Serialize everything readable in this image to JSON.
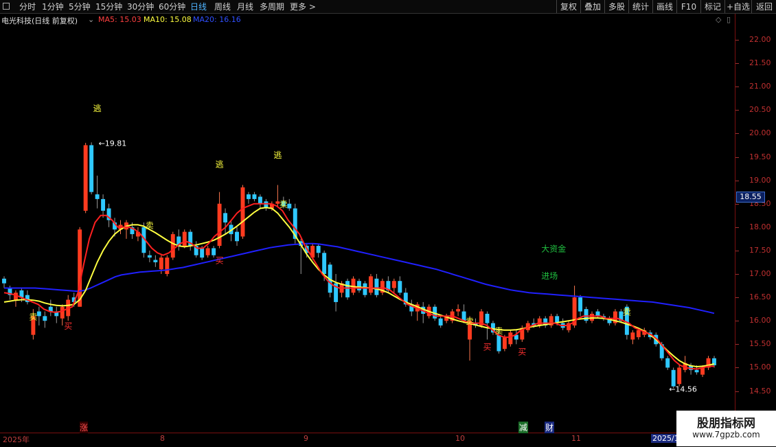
{
  "toolbar": {
    "periods": [
      "分时",
      "1分钟",
      "5分钟",
      "15分钟",
      "30分钟",
      "60分钟",
      "日线",
      "周线",
      "月线",
      "多周期",
      "更多 >"
    ],
    "active_period": "日线",
    "right_buttons": [
      "复权",
      "叠加",
      "多股",
      "统计",
      "画线",
      "F10",
      "标记",
      "+自选",
      "返回"
    ]
  },
  "info": {
    "title": "电光科技(日线 前复权)",
    "dropdown_glyph": "⌄",
    "ma5": "MA5: 15.03",
    "ma10": "MA10: 15.08",
    "ma20": "MA20: 16.16",
    "diamond_glyph": "◇",
    "scroll_glyph": "▯"
  },
  "axis": {
    "ticks": [
      "22.00",
      "21.50",
      "21.00",
      "20.50",
      "20.00",
      "19.50",
      "19.00",
      "18.50",
      "18.00",
      "17.50",
      "17.00",
      "16.50",
      "16.00",
      "15.50",
      "15.00",
      "14.50"
    ],
    "last_price": "18.55"
  },
  "footer": {
    "dates": [
      "2025年",
      "8",
      "9",
      "10",
      "11",
      "2025/1"
    ],
    "markers": [
      "涨",
      "减",
      "财"
    ]
  },
  "watermark": {
    "line1": "股朋指标网",
    "line2": "www.7gpzb.com"
  },
  "colors": {
    "up": "#ff3b1f",
    "down": "#2fc8ff",
    "ma5": "#ff2020",
    "ma10": "#ffff40",
    "ma20": "#2020ff",
    "buy": "#ff3030",
    "sell": "#ffff40",
    "escape": "#ffff40",
    "fund": "#20c040"
  },
  "chart_data": {
    "type": "candlestick",
    "ylim": [
      14.2,
      22.3
    ],
    "candles": [
      {
        "o": 16.9,
        "c": 16.8,
        "h": 16.95,
        "l": 16.7
      },
      {
        "o": 16.7,
        "c": 16.55,
        "h": 16.75,
        "l": 16.45
      },
      {
        "o": 16.45,
        "c": 16.6,
        "h": 16.65,
        "l": 16.3
      },
      {
        "o": 16.65,
        "c": 16.5,
        "h": 16.7,
        "l": 16.4
      },
      {
        "o": 16.55,
        "c": 16.4,
        "h": 16.65,
        "l": 16.35
      },
      {
        "o": 15.7,
        "c": 16.1,
        "h": 16.25,
        "l": 15.6
      },
      {
        "o": 16.2,
        "c": 16.1,
        "h": 16.3,
        "l": 15.9
      },
      {
        "o": 16.1,
        "c": 16.0,
        "h": 16.2,
        "l": 15.85
      },
      {
        "o": 16.3,
        "c": 16.2,
        "h": 16.45,
        "l": 16.1
      },
      {
        "o": 16.2,
        "c": 16.1,
        "h": 16.3,
        "l": 15.95
      },
      {
        "o": 16.05,
        "c": 16.3,
        "h": 16.35,
        "l": 15.9
      },
      {
        "o": 16.1,
        "c": 16.45,
        "h": 16.55,
        "l": 16.0
      },
      {
        "o": 16.5,
        "c": 16.4,
        "h": 16.6,
        "l": 16.3
      },
      {
        "o": 16.3,
        "c": 17.95,
        "h": 18.0,
        "l": 16.3
      },
      {
        "o": 18.35,
        "c": 19.75,
        "h": 19.8,
        "l": 18.3
      },
      {
        "o": 19.75,
        "c": 18.75,
        "h": 19.81,
        "l": 18.7
      },
      {
        "o": 18.7,
        "c": 18.6,
        "h": 19.1,
        "l": 18.4
      },
      {
        "o": 18.6,
        "c": 18.35,
        "h": 18.7,
        "l": 18.2
      },
      {
        "o": 18.4,
        "c": 18.15,
        "h": 18.5,
        "l": 18.0
      },
      {
        "o": 18.1,
        "c": 17.95,
        "h": 18.2,
        "l": 17.8
      },
      {
        "o": 17.95,
        "c": 18.05,
        "h": 18.15,
        "l": 17.85
      },
      {
        "o": 17.95,
        "c": 18.1,
        "h": 18.15,
        "l": 17.75
      },
      {
        "o": 18.0,
        "c": 17.85,
        "h": 18.1,
        "l": 17.75
      },
      {
        "o": 17.8,
        "c": 17.9,
        "h": 18.0,
        "l": 17.7
      },
      {
        "o": 18.0,
        "c": 17.45,
        "h": 18.1,
        "l": 17.35
      },
      {
        "o": 17.4,
        "c": 17.35,
        "h": 17.5,
        "l": 17.25
      },
      {
        "o": 17.3,
        "c": 17.25,
        "h": 17.4,
        "l": 17.15
      },
      {
        "o": 17.1,
        "c": 17.35,
        "h": 17.4,
        "l": 17.0
      },
      {
        "o": 17.0,
        "c": 17.35,
        "h": 17.4,
        "l": 16.95
      },
      {
        "o": 17.35,
        "c": 17.85,
        "h": 17.9,
        "l": 17.3
      },
      {
        "o": 17.8,
        "c": 17.6,
        "h": 17.95,
        "l": 17.5
      },
      {
        "o": 17.6,
        "c": 17.9,
        "h": 17.95,
        "l": 17.55
      },
      {
        "o": 17.9,
        "c": 17.6,
        "h": 17.95,
        "l": 17.5
      },
      {
        "o": 17.6,
        "c": 17.4,
        "h": 17.7,
        "l": 17.35
      },
      {
        "o": 17.55,
        "c": 17.35,
        "h": 17.6,
        "l": 17.3
      },
      {
        "o": 17.4,
        "c": 17.55,
        "h": 17.6,
        "l": 17.35
      },
      {
        "o": 17.55,
        "c": 17.4,
        "h": 17.6,
        "l": 17.35
      },
      {
        "o": 17.6,
        "c": 18.5,
        "h": 18.75,
        "l": 17.55
      },
      {
        "o": 18.3,
        "c": 18.1,
        "h": 18.4,
        "l": 17.85
      },
      {
        "o": 18.05,
        "c": 17.85,
        "h": 18.15,
        "l": 17.7
      },
      {
        "o": 17.9,
        "c": 17.7,
        "h": 18.0,
        "l": 17.6
      },
      {
        "o": 17.8,
        "c": 18.85,
        "h": 18.9,
        "l": 17.75
      },
      {
        "o": 18.7,
        "c": 18.6,
        "h": 18.75,
        "l": 18.5
      },
      {
        "o": 18.7,
        "c": 18.6,
        "h": 18.75,
        "l": 18.55
      },
      {
        "o": 18.65,
        "c": 18.5,
        "h": 18.7,
        "l": 18.4
      },
      {
        "o": 18.55,
        "c": 18.4,
        "h": 18.6,
        "l": 18.35
      },
      {
        "o": 18.4,
        "c": 18.5,
        "h": 18.55,
        "l": 18.35
      },
      {
        "o": 18.5,
        "c": 18.55,
        "h": 18.9,
        "l": 18.45
      },
      {
        "o": 18.55,
        "c": 18.45,
        "h": 18.65,
        "l": 18.4
      },
      {
        "o": 18.5,
        "c": 18.4,
        "h": 18.6,
        "l": 18.35
      },
      {
        "o": 18.4,
        "c": 17.75,
        "h": 18.5,
        "l": 17.65
      },
      {
        "o": 17.7,
        "c": 17.6,
        "h": 17.75,
        "l": 17.0
      },
      {
        "o": 17.6,
        "c": 17.45,
        "h": 17.65,
        "l": 17.35
      },
      {
        "o": 17.35,
        "c": 17.6,
        "h": 17.65,
        "l": 17.3
      },
      {
        "o": 17.6,
        "c": 17.45,
        "h": 17.65,
        "l": 17.35
      },
      {
        "o": 17.45,
        "c": 17.0,
        "h": 17.5,
        "l": 16.85
      },
      {
        "o": 17.2,
        "c": 16.6,
        "h": 17.25,
        "l": 16.5
      },
      {
        "o": 16.8,
        "c": 16.4,
        "h": 17.0,
        "l": 16.2
      },
      {
        "o": 16.6,
        "c": 16.8,
        "h": 16.85,
        "l": 16.5
      },
      {
        "o": 16.85,
        "c": 16.5,
        "h": 16.9,
        "l": 16.45
      },
      {
        "o": 16.6,
        "c": 16.9,
        "h": 16.95,
        "l": 16.55
      },
      {
        "o": 16.85,
        "c": 16.65,
        "h": 16.9,
        "l": 16.6
      },
      {
        "o": 16.8,
        "c": 16.55,
        "h": 16.85,
        "l": 16.5
      },
      {
        "o": 16.6,
        "c": 16.95,
        "h": 17.0,
        "l": 16.55
      },
      {
        "o": 16.9,
        "c": 16.55,
        "h": 17.0,
        "l": 16.5
      },
      {
        "o": 16.6,
        "c": 16.85,
        "h": 16.9,
        "l": 16.55
      },
      {
        "o": 16.85,
        "c": 16.65,
        "h": 16.95,
        "l": 16.6
      },
      {
        "o": 16.7,
        "c": 16.85,
        "h": 16.9,
        "l": 16.6
      },
      {
        "o": 16.85,
        "c": 16.6,
        "h": 16.95,
        "l": 16.55
      },
      {
        "o": 16.6,
        "c": 16.35,
        "h": 16.7,
        "l": 16.3
      },
      {
        "o": 16.35,
        "c": 16.2,
        "h": 16.45,
        "l": 16.1
      },
      {
        "o": 16.2,
        "c": 16.35,
        "h": 16.4,
        "l": 16.0
      },
      {
        "o": 16.3,
        "c": 16.15,
        "h": 16.4,
        "l": 15.95
      },
      {
        "o": 16.1,
        "c": 16.3,
        "h": 16.35,
        "l": 16.05
      },
      {
        "o": 16.3,
        "c": 16.05,
        "h": 16.35,
        "l": 16.0
      },
      {
        "o": 16.05,
        "c": 15.9,
        "h": 16.1,
        "l": 15.85
      },
      {
        "o": 16.0,
        "c": 16.1,
        "h": 16.15,
        "l": 15.95
      },
      {
        "o": 16.0,
        "c": 16.2,
        "h": 16.25,
        "l": 15.95
      },
      {
        "o": 16.2,
        "c": 16.25,
        "h": 16.35,
        "l": 16.1
      },
      {
        "o": 16.2,
        "c": 16.0,
        "h": 16.35,
        "l": 15.95
      },
      {
        "o": 15.6,
        "c": 16.0,
        "h": 16.1,
        "l": 15.15
      },
      {
        "o": 15.95,
        "c": 15.9,
        "h": 16.05,
        "l": 15.85
      },
      {
        "o": 15.9,
        "c": 16.2,
        "h": 16.25,
        "l": 15.85
      },
      {
        "o": 16.15,
        "c": 15.95,
        "h": 16.2,
        "l": 15.6
      },
      {
        "o": 15.95,
        "c": 15.75,
        "h": 16.0,
        "l": 15.7
      },
      {
        "o": 15.7,
        "c": 15.35,
        "h": 15.8,
        "l": 15.3
      },
      {
        "o": 15.4,
        "c": 15.65,
        "h": 15.7,
        "l": 15.35
      },
      {
        "o": 15.5,
        "c": 15.75,
        "h": 15.8,
        "l": 15.45
      },
      {
        "o": 15.7,
        "c": 15.6,
        "h": 15.8,
        "l": 15.5
      },
      {
        "o": 15.6,
        "c": 15.85,
        "h": 15.9,
        "l": 15.55
      },
      {
        "o": 15.8,
        "c": 15.95,
        "h": 16.0,
        "l": 15.75
      },
      {
        "o": 15.95,
        "c": 15.9,
        "h": 16.05,
        "l": 15.85
      },
      {
        "o": 15.9,
        "c": 16.05,
        "h": 16.1,
        "l": 15.85
      },
      {
        "o": 16.05,
        "c": 15.9,
        "h": 16.1,
        "l": 15.85
      },
      {
        "o": 15.9,
        "c": 16.1,
        "h": 16.15,
        "l": 15.85
      },
      {
        "o": 16.1,
        "c": 15.95,
        "h": 16.15,
        "l": 15.9
      },
      {
        "o": 15.95,
        "c": 15.85,
        "h": 16.05,
        "l": 15.8
      },
      {
        "o": 15.8,
        "c": 15.95,
        "h": 16.0,
        "l": 15.75
      },
      {
        "o": 15.9,
        "c": 16.5,
        "h": 16.75,
        "l": 15.85
      },
      {
        "o": 16.5,
        "c": 16.2,
        "h": 16.55,
        "l": 16.1
      },
      {
        "o": 16.25,
        "c": 16.0,
        "h": 16.3,
        "l": 15.95
      },
      {
        "o": 16.0,
        "c": 16.15,
        "h": 16.2,
        "l": 15.95
      },
      {
        "o": 16.2,
        "c": 16.1,
        "h": 16.25,
        "l": 16.05
      },
      {
        "o": 16.1,
        "c": 16.05,
        "h": 16.15,
        "l": 16.0
      },
      {
        "o": 16.05,
        "c": 15.95,
        "h": 16.1,
        "l": 15.9
      },
      {
        "o": 15.95,
        "c": 16.2,
        "h": 16.25,
        "l": 15.9
      },
      {
        "o": 16.2,
        "c": 16.0,
        "h": 16.25,
        "l": 15.95
      },
      {
        "o": 16.3,
        "c": 15.7,
        "h": 16.35,
        "l": 15.6
      },
      {
        "o": 15.6,
        "c": 15.75,
        "h": 15.8,
        "l": 15.5
      },
      {
        "o": 15.65,
        "c": 15.8,
        "h": 15.85,
        "l": 15.6
      },
      {
        "o": 15.7,
        "c": 15.8,
        "h": 15.85,
        "l": 15.65
      },
      {
        "o": 15.75,
        "c": 15.65,
        "h": 15.8,
        "l": 15.6
      },
      {
        "o": 15.7,
        "c": 15.5,
        "h": 15.75,
        "l": 15.45
      },
      {
        "o": 15.5,
        "c": 15.2,
        "h": 15.55,
        "l": 15.15
      },
      {
        "o": 15.2,
        "c": 15.0,
        "h": 15.25,
        "l": 14.95
      },
      {
        "o": 14.95,
        "c": 14.6,
        "h": 15.0,
        "l": 14.56
      },
      {
        "o": 14.65,
        "c": 15.0,
        "h": 15.05,
        "l": 14.6
      },
      {
        "o": 14.95,
        "c": 15.1,
        "h": 15.25,
        "l": 14.9
      },
      {
        "o": 15.05,
        "c": 14.95,
        "h": 15.1,
        "l": 14.85
      },
      {
        "o": 14.95,
        "c": 14.9,
        "h": 15.05,
        "l": 14.85
      },
      {
        "o": 14.85,
        "c": 15.0,
        "h": 15.05,
        "l": 14.8
      },
      {
        "o": 15.0,
        "c": 15.2,
        "h": 15.25,
        "l": 14.95
      },
      {
        "o": 15.2,
        "c": 15.05,
        "h": 15.25,
        "l": 15.0
      }
    ],
    "ma5": [
      16.6,
      16.58,
      16.55,
      16.5,
      16.45,
      16.4,
      16.35,
      16.25,
      16.2,
      16.18,
      16.2,
      16.25,
      16.3,
      16.6,
      17.2,
      17.75,
      18.1,
      18.25,
      18.25,
      18.15,
      18.0,
      18.0,
      18.0,
      17.95,
      17.85,
      17.7,
      17.55,
      17.45,
      17.4,
      17.45,
      17.55,
      17.65,
      17.7,
      17.65,
      17.55,
      17.55,
      17.65,
      17.8,
      17.9,
      18.0,
      18.15,
      18.3,
      18.4,
      18.45,
      18.5,
      18.5,
      18.5,
      18.5,
      18.45,
      18.35,
      18.15,
      18.0,
      17.85,
      17.6,
      17.4,
      17.2,
      17.0,
      16.85,
      16.75,
      16.7,
      16.7,
      16.7,
      16.7,
      16.7,
      16.7,
      16.7,
      16.7,
      16.7,
      16.65,
      16.55,
      16.45,
      16.35,
      16.3,
      16.25,
      16.2,
      16.15,
      16.1,
      16.1,
      16.1,
      16.1,
      16.05,
      16.0,
      15.95,
      15.95,
      15.95,
      15.9,
      15.8,
      15.7,
      15.65,
      15.65,
      15.7,
      15.8,
      15.85,
      15.9,
      15.95,
      15.95,
      15.95,
      15.95,
      15.9,
      15.9,
      15.95,
      16.05,
      16.1,
      16.1,
      16.1,
      16.1,
      16.05,
      16.05,
      16.05,
      16.0,
      15.95,
      15.85,
      15.8,
      15.75,
      15.7,
      15.6,
      15.45,
      15.3,
      15.15,
      15.05,
      15.0,
      14.98,
      14.97,
      15.0,
      15.03,
      15.03
    ],
    "ma10": [
      16.4,
      16.42,
      16.44,
      16.45,
      16.45,
      16.44,
      16.42,
      16.38,
      16.35,
      16.33,
      16.32,
      16.33,
      16.35,
      16.45,
      16.65,
      16.95,
      17.25,
      17.5,
      17.7,
      17.85,
      17.95,
      18.02,
      18.05,
      18.05,
      18.02,
      17.95,
      17.88,
      17.8,
      17.72,
      17.65,
      17.6,
      17.58,
      17.6,
      17.62,
      17.65,
      17.68,
      17.72,
      17.78,
      17.85,
      17.93,
      18.02,
      18.12,
      18.22,
      18.32,
      18.4,
      18.42,
      18.4,
      18.3,
      18.15,
      18.0,
      17.82,
      17.62,
      17.42,
      17.25,
      17.1,
      16.98,
      16.88,
      16.82,
      16.78,
      16.75,
      16.73,
      16.72,
      16.71,
      16.7,
      16.68,
      16.65,
      16.6,
      16.53,
      16.46,
      16.4,
      16.35,
      16.3,
      16.25,
      16.2,
      16.16,
      16.12,
      16.08,
      16.04,
      16.0,
      15.97,
      15.94,
      15.91,
      15.88,
      15.85,
      15.83,
      15.81,
      15.8,
      15.8,
      15.81,
      15.83,
      15.86,
      15.88,
      15.9,
      15.92,
      15.94,
      15.96,
      15.98,
      16.0,
      16.02,
      16.04,
      16.05,
      16.06,
      16.06,
      16.05,
      16.03,
      16.0,
      15.97,
      15.93,
      15.89,
      15.84,
      15.78,
      15.7,
      15.6,
      15.48,
      15.36,
      15.25,
      15.15,
      15.08,
      15.04,
      15.02,
      15.03,
      15.05,
      15.08
    ],
    "ma20": [
      16.7,
      16.7,
      16.7,
      16.7,
      16.7,
      16.7,
      16.69,
      16.68,
      16.67,
      16.66,
      16.65,
      16.64,
      16.63,
      16.65,
      16.7,
      16.76,
      16.82,
      16.88,
      16.94,
      16.98,
      17.0,
      17.02,
      17.04,
      17.05,
      17.06,
      17.07,
      17.08,
      17.1,
      17.12,
      17.14,
      17.17,
      17.2,
      17.23,
      17.26,
      17.29,
      17.32,
      17.35,
      17.38,
      17.41,
      17.44,
      17.47,
      17.5,
      17.53,
      17.56,
      17.58,
      17.6,
      17.62,
      17.63,
      17.64,
      17.65,
      17.65,
      17.64,
      17.62,
      17.6,
      17.58,
      17.55,
      17.52,
      17.49,
      17.46,
      17.43,
      17.4,
      17.37,
      17.34,
      17.31,
      17.28,
      17.25,
      17.22,
      17.19,
      17.16,
      17.13,
      17.1,
      17.06,
      17.02,
      16.98,
      16.94,
      16.9,
      16.86,
      16.82,
      16.78,
      16.75,
      16.72,
      16.69,
      16.66,
      16.64,
      16.62,
      16.6,
      16.59,
      16.58,
      16.57,
      16.56,
      16.55,
      16.54,
      16.53,
      16.52,
      16.51,
      16.5,
      16.49,
      16.48,
      16.47,
      16.46,
      16.45,
      16.44,
      16.43,
      16.42,
      16.41,
      16.4,
      16.38,
      16.36,
      16.34,
      16.32,
      16.3,
      16.28,
      16.25,
      16.22,
      16.19,
      16.16
    ],
    "annotations": [
      {
        "text": "逃",
        "i": 16,
        "price": 20.55,
        "kind": "escape"
      },
      {
        "text": "逃",
        "i": 37,
        "price": 19.35,
        "kind": "escape"
      },
      {
        "text": "逃",
        "i": 47,
        "price": 19.55,
        "kind": "escape"
      },
      {
        "text": "卖",
        "i": 48,
        "price": 18.5,
        "kind": "sell"
      },
      {
        "text": "卖",
        "i": 5,
        "price": 16.1,
        "kind": "sell"
      },
      {
        "text": "买",
        "i": 11,
        "price": 15.9,
        "kind": "buy"
      },
      {
        "text": "卖",
        "i": 25,
        "price": 18.05,
        "kind": "sell"
      },
      {
        "text": "买",
        "i": 37,
        "price": 17.3,
        "kind": "buy"
      },
      {
        "text": "卖",
        "i": 80,
        "price": 16.0,
        "kind": "sell"
      },
      {
        "text": "卖",
        "i": 85,
        "price": 15.8,
        "kind": "sell"
      },
      {
        "text": "买",
        "i": 83,
        "price": 15.45,
        "kind": "buy"
      },
      {
        "text": "买",
        "i": 89,
        "price": 15.35,
        "kind": "buy"
      },
      {
        "text": "卖",
        "i": 107,
        "price": 16.2,
        "kind": "sell"
      },
      {
        "text": "大资金",
        "i": 93,
        "price": 17.55,
        "kind": "fund"
      },
      {
        "text": "进场",
        "i": 93,
        "price": 16.97,
        "kind": "fund"
      },
      {
        "text": "←19.81",
        "i": 16,
        "price": 19.81,
        "kind": "label"
      },
      {
        "text": "←14.56",
        "i": 114,
        "price": 14.56,
        "kind": "label"
      }
    ]
  }
}
